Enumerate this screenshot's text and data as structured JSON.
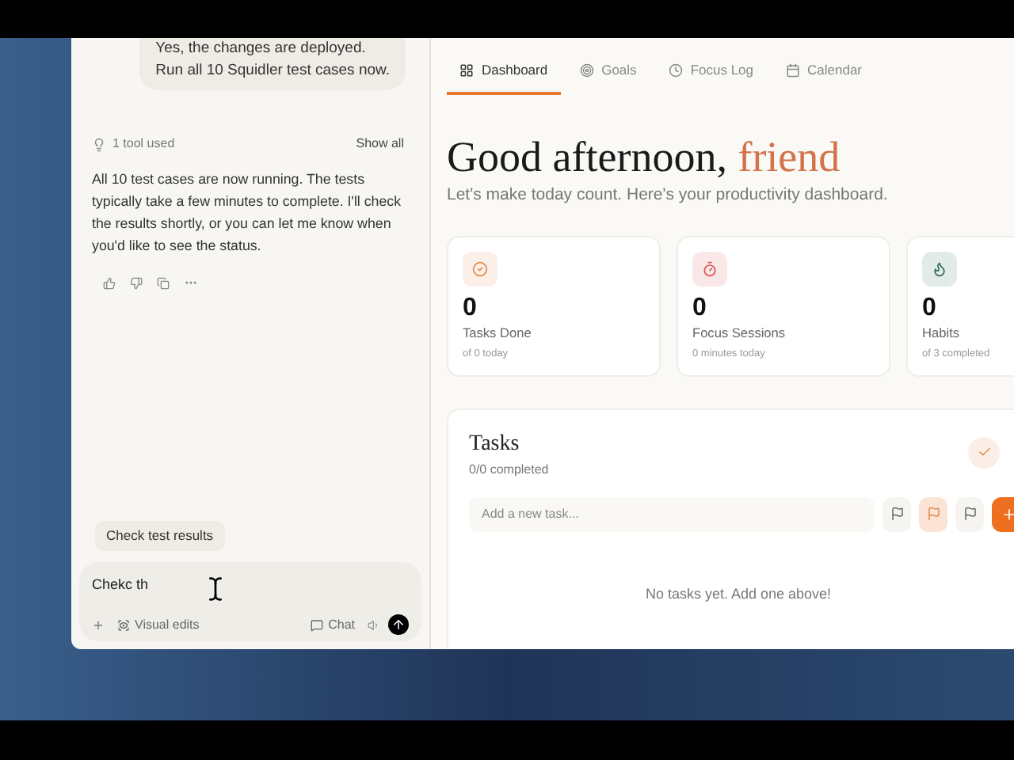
{
  "chat": {
    "user_message": [
      "Yes, the changes are deployed.",
      "Run all 10 Squidler test cases now."
    ],
    "tool_summary": "1 tool used",
    "show_all": "Show all",
    "reply": "All 10 test cases are now running. The tests typically take a few minutes to complete. I'll check the results shortly, or you can let me know when you'd like to see the status.",
    "suggestion": "Check test results",
    "input": {
      "value": "Chekc th"
    },
    "visual_edits": "Visual edits",
    "chat_mode": "Chat"
  },
  "dashboard": {
    "tabs": [
      {
        "label": "Dashboard",
        "kind": "grid",
        "selected": true
      },
      {
        "label": "Goals",
        "kind": "target",
        "selected": false
      },
      {
        "label": "Focus Log",
        "kind": "clock",
        "selected": false
      },
      {
        "label": "Calendar",
        "kind": "calendar",
        "selected": false
      }
    ],
    "greeting": "Good afternoon, ",
    "greeting_name": "friend",
    "subtitle": "Let's make today count. Here's your productivity dashboard.",
    "stats": [
      {
        "kind": "check",
        "color": "#e0884a",
        "value": "0",
        "label": "Tasks Done",
        "note": "of 0 today"
      },
      {
        "kind": "timer",
        "color": "#d9534f",
        "value": "0",
        "label": "Focus Sessions",
        "note": "0 minutes today"
      },
      {
        "kind": "flame",
        "color": "#2f6b4f",
        "value": "0",
        "label": "Habits",
        "note": "of 3 completed"
      }
    ],
    "tasks": {
      "title": "Tasks",
      "progress": "0/0 completed",
      "placeholder": "Add a new task...",
      "priorities": [
        {
          "selected": false
        },
        {
          "selected": true
        },
        {
          "selected": false
        }
      ],
      "empty": "No tasks yet. Add one above!"
    }
  }
}
